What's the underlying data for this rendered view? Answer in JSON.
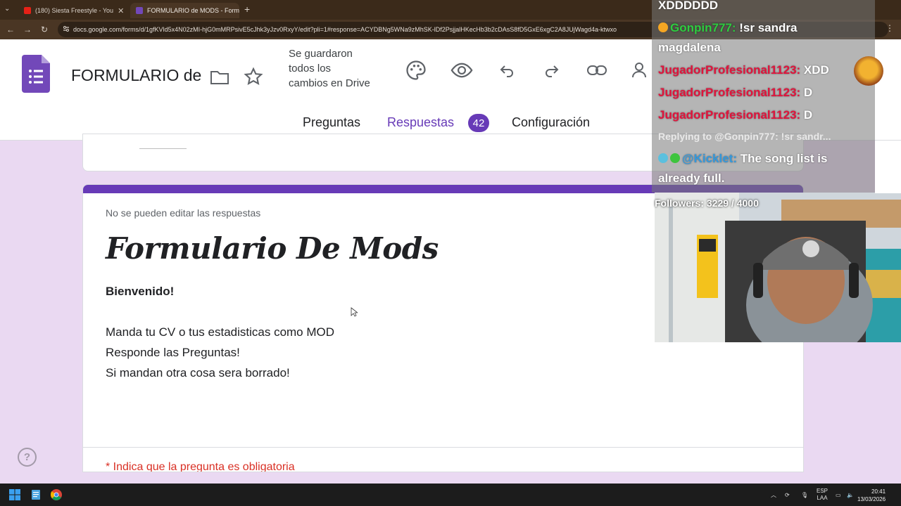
{
  "browser": {
    "tabs": [
      {
        "title": "(180) Siesta Freestyle - You",
        "active": false
      },
      {
        "title": "FORMULARIO de MODS - Form",
        "active": true
      }
    ],
    "url": "docs.google.com/forms/d/1gfKVld5x4N02zMI-hjG0mMRPsivE5cJhk3yJzv0RxyY/edit?pli=1#response=ACYDBNg5WNa9zMhSK-lDf2PsjjalHKecHb3b2cDAsS8fD5GxE6xgC2A8JUjWagd4a-ktwxo"
  },
  "forms_header": {
    "doc_title": "FORMULARIO de",
    "saved_status": "Se guardaron todos los cambios en Drive",
    "tabs": [
      {
        "label": "Preguntas"
      },
      {
        "label": "Respuestas",
        "badge": "42"
      },
      {
        "label": "Configuración"
      }
    ]
  },
  "form": {
    "note": "No se pueden editar las respuestas",
    "title": "Formulario De Mods",
    "welcome": "Bienvenido!",
    "description_lines": [
      "Manda tu CV o tus estadisticas como MOD",
      "Responde las Preguntas!",
      "Si mandan otra cosa sera borrado!"
    ],
    "required_note": "* Indica que la pregunta es obligatoria"
  },
  "chat": {
    "line0": "XDDDDDD",
    "line1_user": "Gonpin777:",
    "line1_msg": "!sr sandra",
    "line2": "magdalena",
    "line3_user": "JugadorProfesional1123:",
    "line3_msg": "XDD",
    "line4_user": "JugadorProfesional1123:",
    "line4_msg": "D",
    "line5_user": "JugadorProfesional1123:",
    "line5_msg": "D",
    "reply": "Replying to @Gonpin777: !sr sandr...",
    "line6_user": "@Kicklet:",
    "line6_msg": "The song list is",
    "line7": "already full.",
    "followers": "Followers: 3229 / 4000"
  },
  "taskbar": {
    "lang_top": "ESP",
    "lang_bottom": "LAA",
    "time": "20:41",
    "date": "13/03/2026"
  },
  "colors": {
    "accent": "#673ab7",
    "background": "#ead9f2",
    "required": "#d93025"
  }
}
